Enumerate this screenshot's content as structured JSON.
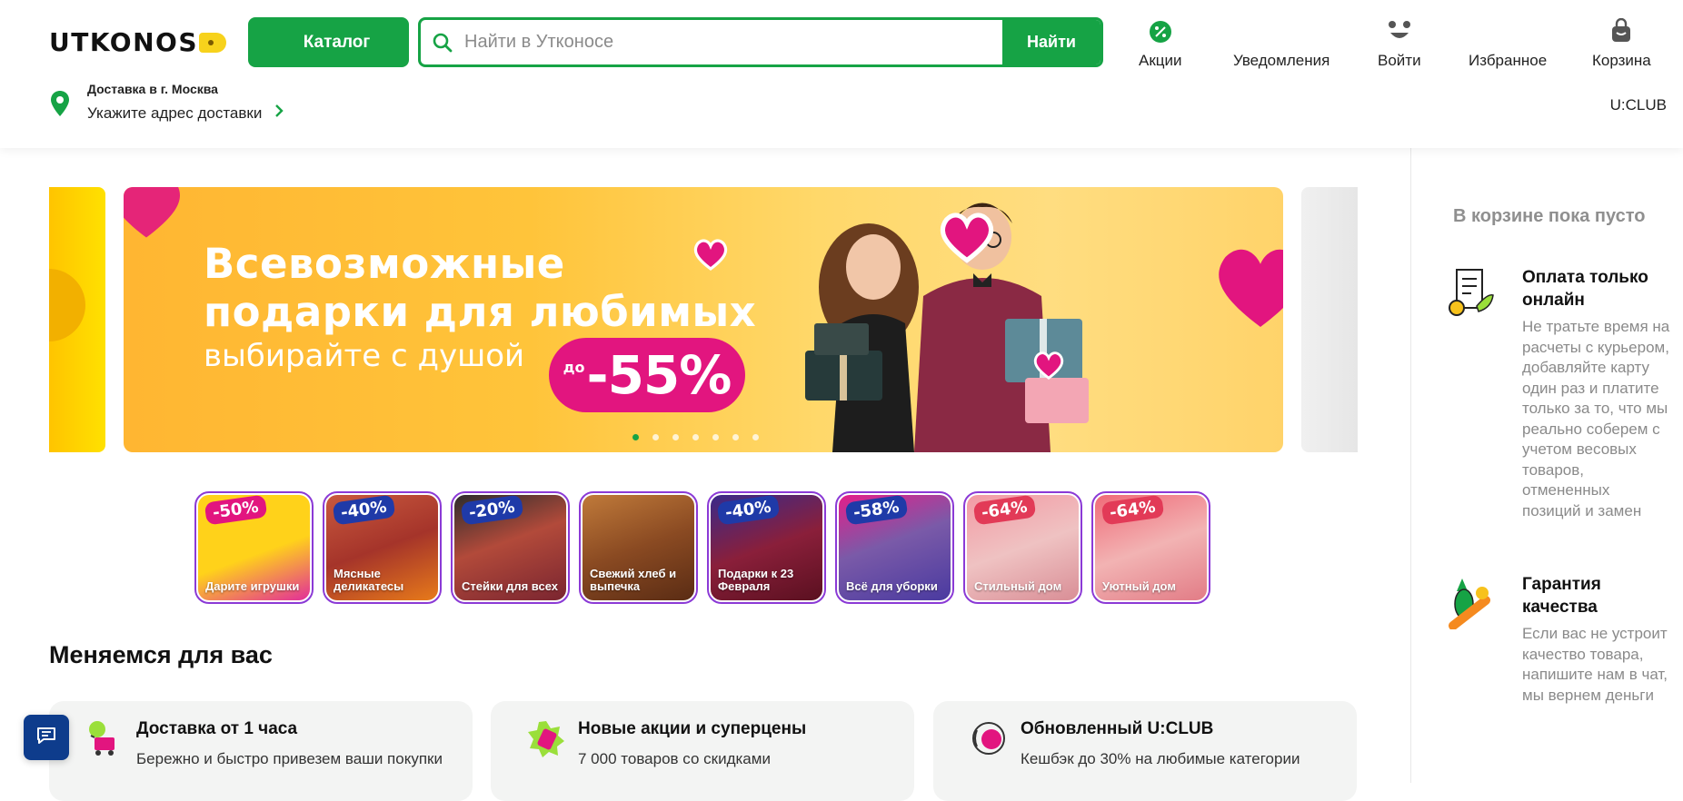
{
  "header": {
    "logo_text": "UTKONOS",
    "catalog_label": "Каталог",
    "search": {
      "placeholder": "Найти в Утконосе",
      "button_label": "Найти"
    },
    "nav": [
      {
        "label": "Акции",
        "icon": "percent-icon"
      },
      {
        "label": "Уведомления",
        "icon": "bell-icon"
      },
      {
        "label": "Войти",
        "icon": "user-face-icon"
      },
      {
        "label": "Избранное",
        "icon": "heart-icon"
      },
      {
        "label": "Корзина",
        "icon": "cart-bag-icon"
      }
    ],
    "delivery": {
      "city": "Доставка в г. Москва",
      "address_prompt": "Укажите адрес доставки"
    },
    "uclub_label": "U:CLUB"
  },
  "banner": {
    "title_line1": "Всевозможные",
    "title_line2": "подарки для любимых",
    "subtitle": "выбирайте с душой",
    "discount_prefix": "до",
    "discount_value": "-55%",
    "slide_count": 7,
    "active_slide": 1
  },
  "categories": [
    {
      "label": "Дарите игрушки",
      "badge": "-50%"
    },
    {
      "label": "Мясные деликатесы",
      "badge": "-40%"
    },
    {
      "label": "Стейки для всех",
      "badge": "-20%"
    },
    {
      "label": "Свежий хлеб и выпечка",
      "badge": ""
    },
    {
      "label": "Подарки к 23 Февраля",
      "badge": "-40%"
    },
    {
      "label": "Всё для уборки",
      "badge": "-58%"
    },
    {
      "label": "Стильный дом",
      "badge": "-64%"
    },
    {
      "label": "Уютный дом",
      "badge": "-64%"
    }
  ],
  "changes": {
    "title": "Меняемся для вас",
    "cards": [
      {
        "title": "Доставка от 1 часа",
        "text": "Бережно и быстро привезем ваши покупки",
        "icon": "delivery-cart-icon"
      },
      {
        "title": "Новые акции и суперцены",
        "text": "7 000 товаров со скидками",
        "icon": "discount-tag-icon"
      },
      {
        "title": "Обновленный U:CLUB",
        "text": "Кешбэк до 30% на любимые категории",
        "icon": "uclub-icon"
      }
    ]
  },
  "sidebar": {
    "cart_empty": "В корзине пока пусто",
    "benefits": [
      {
        "title": "Оплата только онлайн",
        "text": "Не тратьте время на расчеты с курьером, добавляйте карту один раз и платите только за то, что мы реально соберем с учетом весовых товаров, отмененных позиций и замен",
        "icon": "receipt-icon"
      },
      {
        "title": "Гарантия качества",
        "text": "Если вас не устроит качество товара, напишите нам в чат, мы вернем деньги",
        "icon": "vegetables-icon"
      }
    ]
  },
  "colors": {
    "brand_green": "#16a345",
    "logo_yellow": "#f7d21c",
    "accent_pink": "#e2157f",
    "tile_border": "#8b3ad6"
  }
}
